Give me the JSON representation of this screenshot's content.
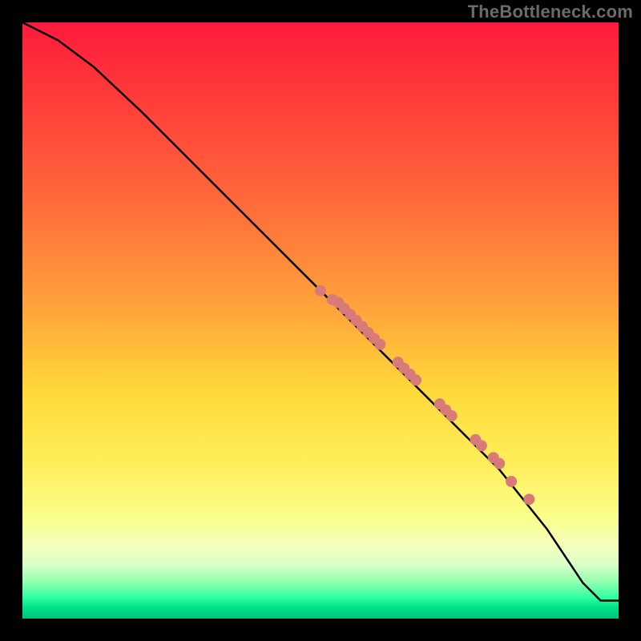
{
  "watermark": "TheBottleneck.com",
  "colors": {
    "background": "#000000",
    "line": "#000000",
    "marker": "#d87b78",
    "watermark": "#6b6b6b"
  },
  "chart_data": {
    "type": "line",
    "title": "",
    "xlabel": "",
    "ylabel": "",
    "xlim": [
      0,
      100
    ],
    "ylim": [
      0,
      100
    ],
    "grid": false,
    "legend": false,
    "curve": {
      "x": [
        0,
        6,
        12,
        20,
        30,
        40,
        50,
        60,
        70,
        80,
        88,
        94,
        97,
        100
      ],
      "y": [
        100,
        97,
        92.5,
        85,
        75,
        65,
        55,
        45,
        35,
        25,
        15,
        6,
        3,
        3
      ]
    },
    "markers": {
      "x": [
        50,
        52,
        53,
        54,
        55,
        56,
        57,
        58,
        59,
        60,
        63,
        64,
        65,
        66,
        70,
        71,
        72,
        76,
        77,
        79,
        80,
        82,
        85
      ],
      "y": [
        55,
        53.5,
        53,
        52,
        51,
        50,
        49,
        48,
        47,
        46,
        43,
        42,
        41,
        40,
        36,
        35,
        34,
        30,
        29,
        27,
        26,
        23,
        20
      ]
    }
  }
}
